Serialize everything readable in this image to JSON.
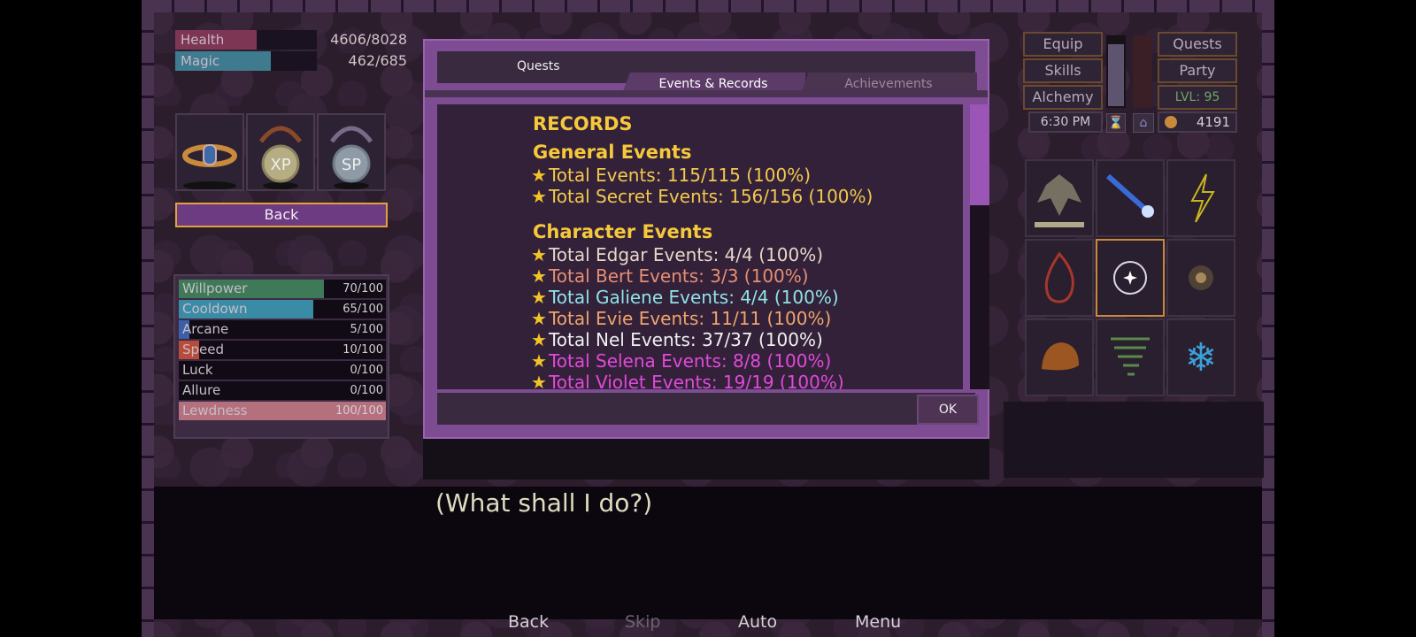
{
  "stats": {
    "health": {
      "label": "Health",
      "value": "4606/8028",
      "fraction": 0.574,
      "color": "#7d3654"
    },
    "magic": {
      "label": "Magic",
      "value": "462/685",
      "fraction": 0.674,
      "color": "#3e7b8e"
    }
  },
  "inventory_slots": [
    {
      "icon": "ring-icon",
      "text": ""
    },
    {
      "icon": "xp-amulet-icon",
      "text": "XP"
    },
    {
      "icon": "sp-amulet-icon",
      "text": "SP"
    }
  ],
  "back_label": "Back",
  "attributes": [
    {
      "label": "Willpower",
      "value": "70/100",
      "fraction": 0.7,
      "color": "#3e7a58"
    },
    {
      "label": "Cooldown",
      "value": "65/100",
      "fraction": 0.65,
      "color": "#3a8ca6"
    },
    {
      "label": "Arcane",
      "value": "5/100",
      "fraction": 0.05,
      "color": "#3b5fa8"
    },
    {
      "label": "Speed",
      "value": "10/100",
      "fraction": 0.1,
      "color": "#b84b3a"
    },
    {
      "label": "Luck",
      "value": "0/100",
      "fraction": 0.0,
      "color": "#777"
    },
    {
      "label": "Allure",
      "value": "0/100",
      "fraction": 0.0,
      "color": "#777"
    },
    {
      "label": "Lewdness",
      "value": "100/100",
      "fraction": 1.0,
      "color": "#b5707e"
    }
  ],
  "dialog": {
    "title": "Quests",
    "tabs": {
      "active": "Events & Records",
      "inactive": "Achievements"
    },
    "heading": "RECORDS",
    "sections": [
      {
        "title": "General Events",
        "rows": [
          {
            "text": "Total Events: 115/115 (100%)",
            "color": "#f2c94c"
          },
          {
            "text": "Total Secret Events: 156/156 (100%)",
            "color": "#f2c94c"
          }
        ]
      },
      {
        "title": "Character Events",
        "rows": [
          {
            "text": "Total Edgar Events: 4/4 (100%)",
            "color": "#e6d6c6"
          },
          {
            "text": "Total Bert Events: 3/3 (100%)",
            "color": "#e68f72"
          },
          {
            "text": "Total Galiene Events: 4/4 (100%)",
            "color": "#8fe3e6"
          },
          {
            "text": "Total Evie Events: 11/11 (100%)",
            "color": "#f0a46c"
          },
          {
            "text": "Total Nel Events: 37/37 (100%)",
            "color": "#f0f0f0"
          },
          {
            "text": "Total Selena Events: 8/8 (100%)",
            "color": "#e04ad8"
          },
          {
            "text": "Total Violet Events: 19/19 (100%)",
            "color": "#e04ad8"
          }
        ]
      }
    ],
    "ok_label": "OK"
  },
  "right_buttons": {
    "equip": "Equip",
    "skills": "Skills",
    "alchemy": "Alchemy",
    "quests": "Quests",
    "party": "Party",
    "level": "LVL: 95",
    "time": "6:30 PM",
    "gold": "4191"
  },
  "skill_icons": [
    "eagle-crest-icon",
    "light-beam-icon",
    "lightning-icon",
    "fire-icon",
    "target-sparkle-icon",
    "orb-icon",
    "stone-icon",
    "tornado-icon",
    "snowflake-icon"
  ],
  "dialogue_text": "(What shall I do?)",
  "bottom_nav": {
    "back": "Back",
    "skip": "Skip",
    "auto": "Auto",
    "menu": "Menu"
  }
}
